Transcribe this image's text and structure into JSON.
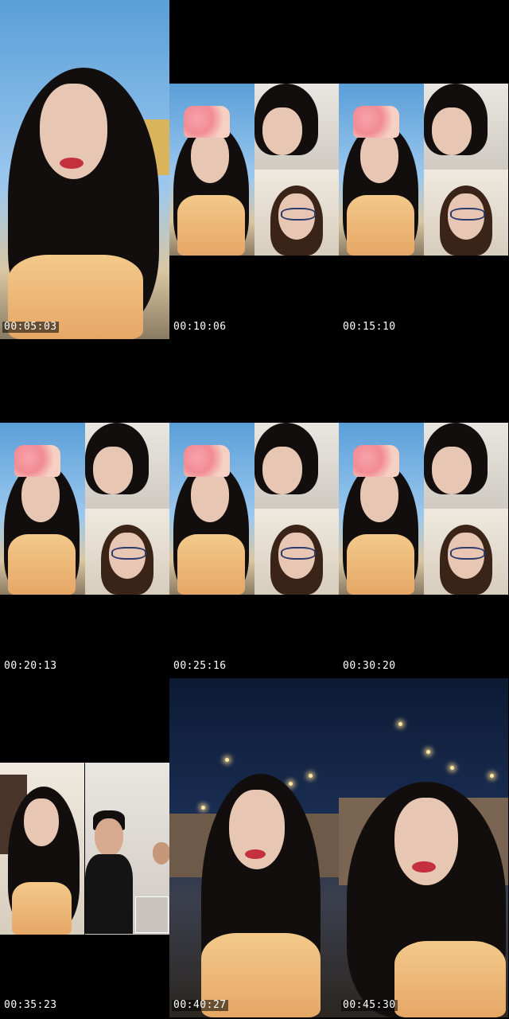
{
  "sheet": {
    "columns": 3,
    "rows": 3,
    "frames": [
      {
        "timestamp": "00:05:03",
        "scene": "single-selfie-day"
      },
      {
        "timestamp": "00:10:06",
        "scene": "video-call-three-way"
      },
      {
        "timestamp": "00:15:10",
        "scene": "video-call-three-way"
      },
      {
        "timestamp": "00:20:13",
        "scene": "video-call-three-way"
      },
      {
        "timestamp": "00:25:16",
        "scene": "video-call-three-way"
      },
      {
        "timestamp": "00:30:20",
        "scene": "video-call-three-way"
      },
      {
        "timestamp": "00:35:23",
        "scene": "video-call-indoor"
      },
      {
        "timestamp": "00:40:27",
        "scene": "selfie-night-backyard"
      },
      {
        "timestamp": "00:45:30",
        "scene": "selfie-night-backyard"
      }
    ]
  },
  "colors": {
    "background": "#000000",
    "timestamp_text": "#ffffff"
  }
}
